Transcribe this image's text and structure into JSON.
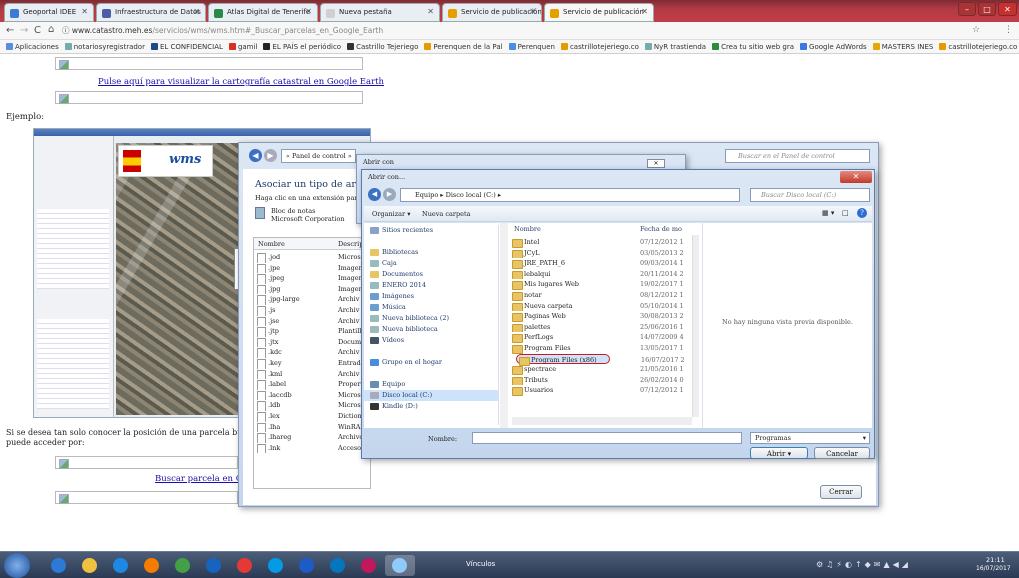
{
  "tabs": [
    {
      "label": "Geoportal IDEE",
      "color": "#3a7bd5"
    },
    {
      "label": "Infraestructura de Datos",
      "color": "#4a5fa8"
    },
    {
      "label": "Atlas Digital de Tenerife",
      "color": "#2a8a4a"
    },
    {
      "label": "Nueva pestaña",
      "color": "#d0d0d0"
    },
    {
      "label": "Servicio de publicación",
      "color": "#e5a000"
    },
    {
      "label": "Servicio de publicación",
      "color": "#e5a000"
    }
  ],
  "address": {
    "host": "www.catastro.meh.es",
    "path": "/servicios/wms/wms.htm#_Buscar_parcelas_en_Google_Earth"
  },
  "bookmarks": [
    {
      "label": "Aplicaciones",
      "color": "#5a8de0"
    },
    {
      "label": "notariosyregistrador",
      "color": "#7aa"
    },
    {
      "label": "EL CONFIDENCIAL",
      "color": "#1c4a8a"
    },
    {
      "label": "gamil",
      "color": "#d93025"
    },
    {
      "label": "EL PAÍS el periódico",
      "color": "#222"
    },
    {
      "label": "Castrillo Tejeriego",
      "color": "#333"
    },
    {
      "label": "Perenquen de la Pal",
      "color": "#e69a00"
    },
    {
      "label": "Perenquen",
      "color": "#4a90e2"
    },
    {
      "label": "castrillotejeriego.co",
      "color": "#e69a00"
    },
    {
      "label": "NyR trastienda",
      "color": "#7aa"
    },
    {
      "label": "Crea tu sitio web gra",
      "color": "#2d8c3c"
    },
    {
      "label": "Google AdWords",
      "color": "#3b78e7"
    },
    {
      "label": "MASTERS INES",
      "color": "#e6a800"
    },
    {
      "label": "castrillotejeriego.co",
      "color": "#e69a00"
    }
  ],
  "page": {
    "link_google_earth": "Pulse aquí para visualizar la cartografía catastral en Google Earth",
    "ejemplo": "Ejemplo:",
    "parcel_text_1": "Si se desea tan solo conocer la posición de una parcela buscando p",
    "parcel_text_2": "puede acceder por:",
    "link_buscar": "Buscar parcela en Googl"
  },
  "control_panel": {
    "breadcrumb": "« Panel de control »",
    "search_placeholder": "Buscar en el Panel de control",
    "heading": "Asociar un tipo de archivo o p",
    "subheading": "Haga clic en una extensión para ver el p",
    "program_name": "Bloc de notas",
    "program_vendor": "Microsoft Corporation",
    "col_name": "Nombre",
    "col_desc": "Descrip",
    "close_label": "Cerrar",
    "rows": [
      {
        "ext": ".jod",
        "desc": "Micros"
      },
      {
        "ext": ".jpe",
        "desc": "Imagen"
      },
      {
        "ext": ".jpeg",
        "desc": "Imagen"
      },
      {
        "ext": ".jpg",
        "desc": "Imagen"
      },
      {
        "ext": ".jpg-large",
        "desc": "Archiv"
      },
      {
        "ext": ".js",
        "desc": "Archiv"
      },
      {
        "ext": ".jse",
        "desc": "Archiv"
      },
      {
        "ext": ".jtp",
        "desc": "Plantill"
      },
      {
        "ext": ".jtx",
        "desc": "Docum"
      },
      {
        "ext": ".kdc",
        "desc": "Archiv"
      },
      {
        "ext": ".key",
        "desc": "Entrada"
      },
      {
        "ext": ".kml",
        "desc": "Archiv"
      },
      {
        "ext": ".label",
        "desc": "Propert"
      },
      {
        "ext": ".laccdb",
        "desc": "Micros"
      },
      {
        "ext": ".ldb",
        "desc": "Micros"
      },
      {
        "ext": ".lex",
        "desc": "Diction"
      },
      {
        "ext": ".lha",
        "desc": "WinRAR"
      },
      {
        "ext": ".lhareg",
        "desc": "Archivo"
      },
      {
        "ext": ".lnk",
        "desc": "Acceso"
      }
    ]
  },
  "open_with": {
    "title": "Abrir con"
  },
  "open_dialog": {
    "title": "Abrir con...",
    "path": "Equipo ▸ Disco local (C:) ▸",
    "search_placeholder": "Buscar Disco local (C:)",
    "organize": "Organizar ▾",
    "new_folder": "Nueva carpeta",
    "col_name": "Nombre",
    "col_date": "Fecha de mo",
    "preview": "No hay ninguna vista previa disponible.",
    "filename_label": "Nombre:",
    "filter": "Programas",
    "open": "Abrir",
    "cancel": "Cancelar",
    "nav": [
      {
        "label": "Sitios recientes",
        "color": "#8aa2c8"
      },
      {
        "label": "",
        "color": ""
      },
      {
        "label": "Bibliotecas",
        "color": "#e8c464"
      },
      {
        "label": "Caja",
        "color": "#9bb"
      },
      {
        "label": "Documentos",
        "color": "#e8c464"
      },
      {
        "label": "ENERO 2014",
        "color": "#9bb"
      },
      {
        "label": "Imágenes",
        "color": "#6a9ed0"
      },
      {
        "label": "Música",
        "color": "#6a9ed0"
      },
      {
        "label": "Nueva biblioteca (2)",
        "color": "#9bb"
      },
      {
        "label": "Nueva biblioteca",
        "color": "#9bb"
      },
      {
        "label": "Vídeos",
        "color": "#456"
      },
      {
        "label": "",
        "color": ""
      },
      {
        "label": "Grupo en el hogar",
        "color": "#4a8adf"
      },
      {
        "label": "",
        "color": ""
      },
      {
        "label": "Equipo",
        "color": "#6b8bb0"
      },
      {
        "label": "Disco local (C:)",
        "color": "#aab"
      },
      {
        "label": "Kindle (D:)",
        "color": "#333"
      }
    ],
    "folders": [
      {
        "name": "Intel",
        "date": "07/12/2012 1"
      },
      {
        "name": "JCyL",
        "date": "03/05/2013 2"
      },
      {
        "name": "JRE_PATH_6",
        "date": "09/03/2014 1"
      },
      {
        "name": "lebalqui",
        "date": "20/11/2014 2"
      },
      {
        "name": "Mis lugares Web",
        "date": "19/02/2017 1"
      },
      {
        "name": "notar",
        "date": "08/12/2012 1"
      },
      {
        "name": "Nueva carpeta",
        "date": "05/10/2014 1"
      },
      {
        "name": "Paginas Web",
        "date": "30/08/2013 2"
      },
      {
        "name": "palettes",
        "date": "25/06/2016 1"
      },
      {
        "name": "PerfLogs",
        "date": "14/07/2009 4"
      },
      {
        "name": "Program Files",
        "date": "13/05/2017 1"
      },
      {
        "name": "Program Files (x86)",
        "date": "16/07/2017 2"
      },
      {
        "name": "spectrace",
        "date": "21/05/2016 1"
      },
      {
        "name": "Tributs",
        "date": "26/02/2014 0"
      },
      {
        "name": "Usuarios",
        "date": "07/12/2012 1"
      }
    ]
  },
  "taskbar": {
    "vinculos": "Vínculos",
    "time": "21:11",
    "date": "16/07/2017",
    "apps": [
      "#2b7bd6",
      "#f0c040",
      "#1e88e5",
      "#f57c00",
      "#43a047",
      "#1565c0",
      "#e53935",
      "#039be5",
      "#1e5bc6",
      "#0277bd",
      "#c2185b",
      "#90caf9"
    ]
  }
}
